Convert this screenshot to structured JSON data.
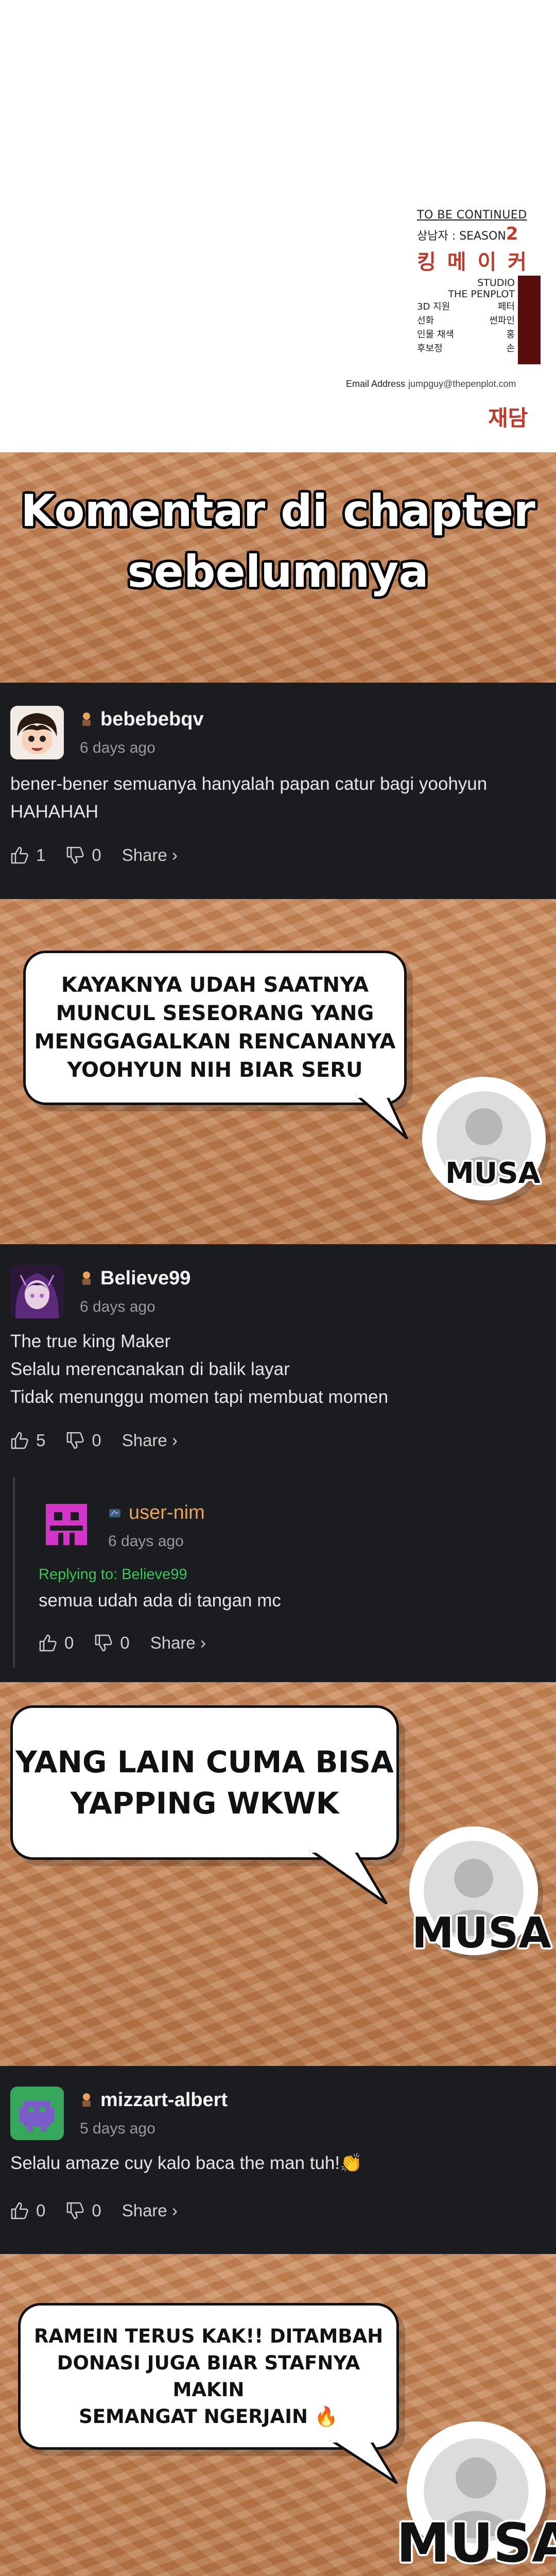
{
  "credits": {
    "to_be_continued": "TO BE CONTINUED",
    "season_prefix": "상남자 : SEASON",
    "season_number": "2",
    "title_logo": "킹 메 이 커",
    "studio": "STUDIO",
    "studio_name": "THE PENPLOT",
    "staff": [
      {
        "role": "3D 지원",
        "name": "페터"
      },
      {
        "role": "선화",
        "name": "썬파인"
      },
      {
        "role": "인물 채색",
        "name": "홍"
      },
      {
        "role": "후보정",
        "name": "손"
      }
    ],
    "email_label": "Email Address",
    "email_value": "jumpguy@thepenplot.com",
    "publisher": "재담"
  },
  "heading": {
    "line1": "Komentar di chapter",
    "line2": "sebelumnya"
  },
  "comments": [
    {
      "username": "bebebebqv",
      "time": "6 days ago",
      "lines": [
        "bener-bener semuanya hanyalah papan catur bagi yoohyun",
        "HAHAHAH"
      ],
      "likes": "1",
      "dislikes": "0",
      "share": "Share ›"
    },
    {
      "username": "Believe99",
      "time": "6 days ago",
      "lines": [
        "The true king Maker",
        "Selalu merencanakan di balik layar",
        "Tidak menunggu momen tapi membuat momen"
      ],
      "likes": "5",
      "dislikes": "0",
      "share": "Share ›",
      "reply": {
        "username": "user-nim",
        "time": "6 days ago",
        "replying_to": "Replying to: Believe99",
        "text": "semua udah ada di tangan mc",
        "likes": "0",
        "dislikes": "0",
        "share": "Share ›"
      }
    },
    {
      "username": "mizzart-albert",
      "time": "5 days ago",
      "text": "Selalu amaze cuy kalo baca the man tuh!👏",
      "likes": "0",
      "dislikes": "0",
      "share": "Share ›"
    }
  ],
  "bubbles": [
    {
      "lines": [
        "KAYAKNYA UDAH SAATNYA",
        "MUNCUL SESEORANG YANG",
        "MENGGAGALKAN RENCANANYA",
        "YOOHYUN NIH BIAR SERU"
      ],
      "name": "MUSA"
    },
    {
      "lines": [
        "YANG LAIN CUMA BISA",
        "YAPPING WKWK"
      ],
      "name": "MUSA"
    },
    {
      "lines": [
        "RAMEIN TERUS KAK!! DITAMBAH",
        "DONASI JUGA BIAR STAFNYA MAKIN",
        "SEMANGAT NGERJAIN 🔥"
      ],
      "name": "MUSA"
    }
  ],
  "colors": {
    "dark_bg": "#1b1c20",
    "reply_name": "#e8a25a",
    "replying_green": "#34c759",
    "accent_red": "#c0392b",
    "sand": "#c08250"
  }
}
